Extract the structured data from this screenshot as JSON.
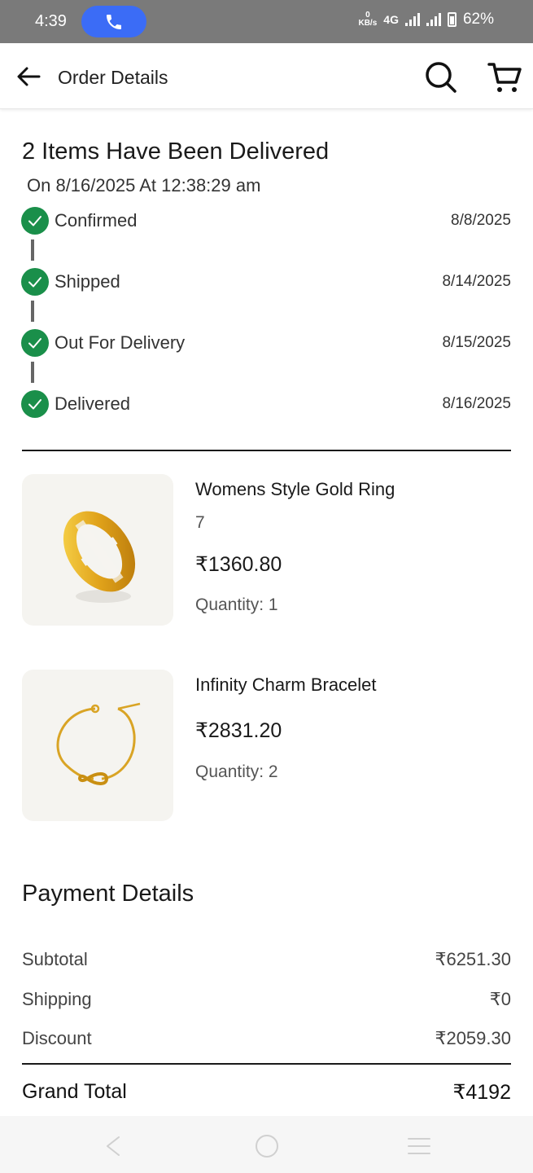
{
  "status_bar": {
    "time": "4:39",
    "speed_value": "0",
    "speed_unit": "KB/s",
    "network": "4G",
    "battery": "62%"
  },
  "app_bar": {
    "title": "Order Details",
    "icons": [
      "back-arrow-icon",
      "search-icon",
      "cart-icon"
    ]
  },
  "delivery": {
    "headline": "2 Items Have Been Delivered",
    "subline": "On 8/16/2025 At 12:38:29 am",
    "status_color": "#1a8f4a",
    "steps": [
      {
        "label": "Confirmed",
        "date": "8/8/2025"
      },
      {
        "label": "Shipped",
        "date": "8/14/2025"
      },
      {
        "label": "Out For Delivery",
        "date": "8/15/2025"
      },
      {
        "label": "Delivered",
        "date": "8/16/2025"
      }
    ]
  },
  "items": [
    {
      "name": "Womens Style Gold Ring",
      "variant": "7",
      "price": "₹1360.80",
      "quantity": "Quantity: 1"
    },
    {
      "name": "Infinity Charm Bracelet",
      "price": "₹2831.20",
      "quantity": "Quantity: 2"
    }
  ],
  "payment": {
    "title": "Payment Details",
    "rows": [
      {
        "label": "Subtotal",
        "value": "₹6251.30"
      },
      {
        "label": "Shipping",
        "value": "₹0"
      },
      {
        "label": "Discount",
        "value": "₹2059.30"
      }
    ],
    "grand_total": {
      "label": "Grand Total",
      "value": "₹4192"
    }
  },
  "nav_bar": {
    "icons": [
      "nav-back-icon",
      "nav-home-icon",
      "nav-menu-icon"
    ]
  }
}
